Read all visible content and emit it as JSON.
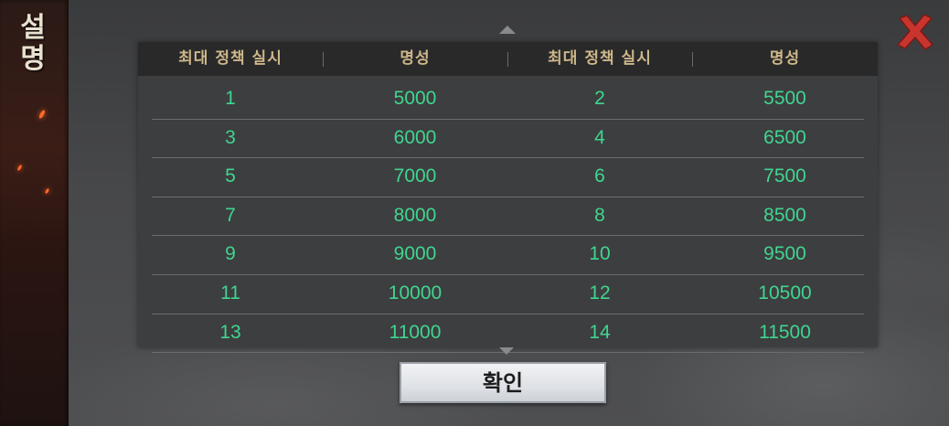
{
  "side_title": [
    "설",
    "명"
  ],
  "table": {
    "headers": [
      "최대 정책 실시",
      "명성",
      "최대 정책 실시",
      "명성"
    ],
    "rows": [
      [
        "1",
        "5000",
        "2",
        "5500"
      ],
      [
        "3",
        "6000",
        "4",
        "6500"
      ],
      [
        "5",
        "7000",
        "6",
        "7500"
      ],
      [
        "7",
        "8000",
        "8",
        "8500"
      ],
      [
        "9",
        "9000",
        "10",
        "9500"
      ],
      [
        "11",
        "10000",
        "12",
        "10500"
      ],
      [
        "13",
        "11000",
        "14",
        "11500"
      ]
    ]
  },
  "confirm_label": "확인",
  "icons": {
    "close": "close-icon",
    "scroll_up": "scroll-up-icon",
    "scroll_down": "scroll-down-icon"
  },
  "colors": {
    "value_text": "#3fd68f",
    "header_text": "#cdb78a",
    "close_red": "#c8352f"
  }
}
